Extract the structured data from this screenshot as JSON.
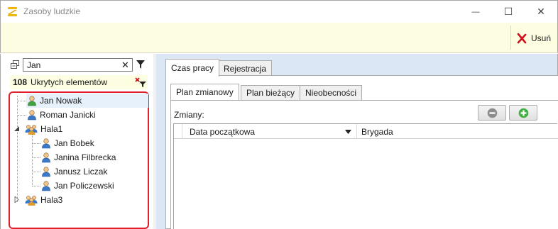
{
  "window": {
    "title": "Zasoby ludzkie",
    "minimize_glyph": "—",
    "maximize_glyph": "☐",
    "close_glyph": "✕"
  },
  "ribbon": {
    "delete_label": "Usuń",
    "delete_icon": "red-x-icon"
  },
  "search": {
    "value": "Jan",
    "clear_glyph": "✕"
  },
  "hidden": {
    "count": "108",
    "label": "Ukrytych elementów"
  },
  "tree": {
    "items": [
      {
        "label": "Jan Nowak",
        "type": "person",
        "selected": true
      },
      {
        "label": "Roman Janicki",
        "type": "person"
      },
      {
        "label": "Hala1",
        "type": "group",
        "expanded": true
      },
      {
        "label": "Jan Bobek",
        "type": "person"
      },
      {
        "label": "Janina Filbrecka",
        "type": "person"
      },
      {
        "label": "Janusz Liczak",
        "type": "person"
      },
      {
        "label": "Jan Policzewski",
        "type": "person"
      },
      {
        "label": "Hala3",
        "type": "group",
        "expanded": false
      }
    ]
  },
  "tabs": {
    "main": [
      "Czas pracy",
      "Rejestracja"
    ],
    "sub": [
      "Plan zmianowy",
      "Plan bieżący",
      "Nieobecności"
    ]
  },
  "shifts": {
    "label": "Zmiany:",
    "remove_icon": "minus-circle-icon",
    "add_icon": "plus-circle-icon",
    "columns": [
      "Data początkowa",
      "Brygada"
    ]
  },
  "colors": {
    "ribbon_bg": "#fdfde2",
    "right_bg": "#dce7f5",
    "highlight_border": "#e0212b",
    "selected_row": "#e6f1fb"
  }
}
